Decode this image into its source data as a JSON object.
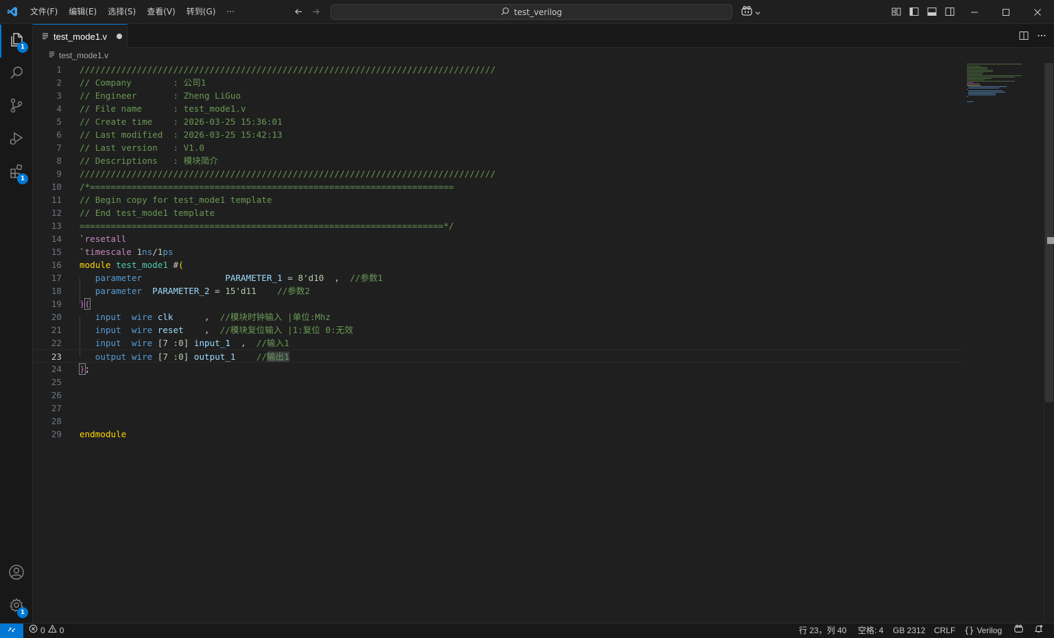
{
  "menu": [
    "文件(F)",
    "编辑(E)",
    "选择(S)",
    "查看(V)",
    "转到(G)",
    "···"
  ],
  "search": {
    "label": "test_verilog"
  },
  "activity": {
    "explorer_badge": "1",
    "extensions_badge": "1",
    "settings_badge": "1"
  },
  "tab": {
    "label": "test_mode1.v"
  },
  "breadcrumb": {
    "file": "test_mode1.v"
  },
  "editor": {
    "current_line": 23,
    "lines": [
      {
        "n": "1"
      },
      {
        "n": "2"
      },
      {
        "n": "3"
      },
      {
        "n": "4"
      },
      {
        "n": "5"
      },
      {
        "n": "6"
      },
      {
        "n": "7"
      },
      {
        "n": "8"
      },
      {
        "n": "9"
      },
      {
        "n": "10"
      },
      {
        "n": "11"
      },
      {
        "n": "12"
      },
      {
        "n": "13"
      },
      {
        "n": "14"
      },
      {
        "n": "15"
      },
      {
        "n": "16"
      },
      {
        "n": "17"
      },
      {
        "n": "18"
      },
      {
        "n": "19"
      },
      {
        "n": "20"
      },
      {
        "n": "21"
      },
      {
        "n": "22"
      },
      {
        "n": "23"
      },
      {
        "n": "24"
      },
      {
        "n": "25"
      },
      {
        "n": "26"
      },
      {
        "n": "27"
      },
      {
        "n": "28"
      },
      {
        "n": "29"
      }
    ],
    "code": {
      "l1": "////////////////////////////////////////////////////////////////////////////////",
      "l2": "// Company        : 公司1",
      "l3": "// Engineer       : Zheng LiGuo",
      "l4": "// File name      : test_mode1.v",
      "l5": "// Create time    : 2026-03-25 15:36:01",
      "l6": "// Last modified  : 2026-03-25 15:42:13",
      "l7": "// Last version   : V1.0",
      "l8": "// Descriptions   : 模块简介",
      "l9": "////////////////////////////////////////////////////////////////////////////////",
      "l10": "/*======================================================================",
      "l11": "// Begin copy for test_mode1 template",
      "l12": "// End test_mode1 template",
      "l13": "======================================================================*/",
      "l14_a": "`",
      "l14_b": "resetall",
      "l15_a": "`",
      "l15_b": "timescale",
      "l15_c": " ",
      "l15_d": "1",
      "l15_e": "ns",
      "l15_f": "/",
      "l15_g": "1",
      "l15_h": "ps",
      "l16_a": "module",
      "l16_b": " test_mode1 ",
      "l16_c": "#",
      "l16_d": "(",
      "l17_a": "   parameter                ",
      "l17_b": "PARAMETER_1",
      "l17_c": " = ",
      "l17_d": "8'd10",
      "l17_e": "  ,  ",
      "l17_f": "//参数1",
      "l18_a": "   parameter  ",
      "l18_b": "PARAMETER_2",
      "l18_c": " = ",
      "l18_d": "15'd11",
      "l18_e": "    ",
      "l18_f": "//参数2",
      "l19_a": ")",
      "l19_b": "(",
      "l20_a": "   input  wire ",
      "l20_b": "clk",
      "l20_c": "      ,  ",
      "l20_d": "//模块时钟输入 |单位:Mhz",
      "l21_a": "   input  wire ",
      "l21_b": "reset",
      "l21_c": "    ,  ",
      "l21_d": "//模块复位输入 |1:复位 0:无效",
      "l22_a": "   input  wire ",
      "l22_b": "[",
      "l22_c": "7",
      "l22_d": " :",
      "l22_e": "0",
      "l22_f": "] ",
      "l22_g": "input_1",
      "l22_h": "  ,  ",
      "l22_i": "//输入1",
      "l23_a": "   output wire ",
      "l23_b": "[",
      "l23_c": "7",
      "l23_d": " :",
      "l23_e": "0",
      "l23_f": "] ",
      "l23_g": "output_1",
      "l23_h": "    //",
      "l23_i": "输出1",
      "l24_a": ")",
      "l24_b": ";",
      "l29": "endmodule"
    }
  },
  "status": {
    "errors": "0",
    "warnings": "0",
    "position": "行 23，列 40",
    "spaces": "空格: 4",
    "encoding": "GB 2312",
    "eol": "CRLF",
    "language": "Verilog"
  }
}
